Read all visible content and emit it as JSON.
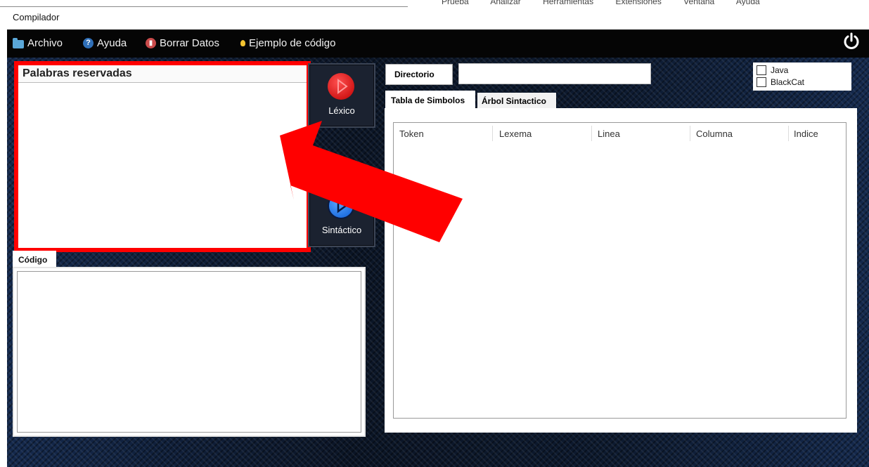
{
  "window": {
    "title": "Compilador",
    "background_menu": [
      "Prueba",
      "Analizar",
      "Herramientas",
      "Extensiones",
      "Ventana",
      "Ayuda"
    ]
  },
  "menubar": {
    "items": [
      {
        "label": "Archivo",
        "icon": "folder-icon"
      },
      {
        "label": "Ayuda",
        "icon": "help-icon"
      },
      {
        "label": "Borrar Datos",
        "icon": "trash-icon"
      },
      {
        "label": "Ejemplo de código",
        "icon": "bulb-icon"
      }
    ],
    "power_icon": "power-icon"
  },
  "palabras": {
    "title": "Palabras reservadas"
  },
  "buttons": {
    "lexico": "Léxico",
    "sintactico": "Sintáctico"
  },
  "codigo": {
    "tab": "Código"
  },
  "directorio": {
    "label": "Directorio",
    "value": ""
  },
  "checkboxes": [
    {
      "label": "Java",
      "checked": false
    },
    {
      "label": "BlackCat",
      "checked": false
    }
  ],
  "tabs": [
    "Tabla de Simbolos",
    "Árbol Sintactico"
  ],
  "table": {
    "columns": [
      "Token",
      "Lexema",
      "Linea",
      "Columna",
      "Indice"
    ]
  },
  "colors": {
    "highlight": "#ff0000",
    "menubar": "#050505"
  }
}
